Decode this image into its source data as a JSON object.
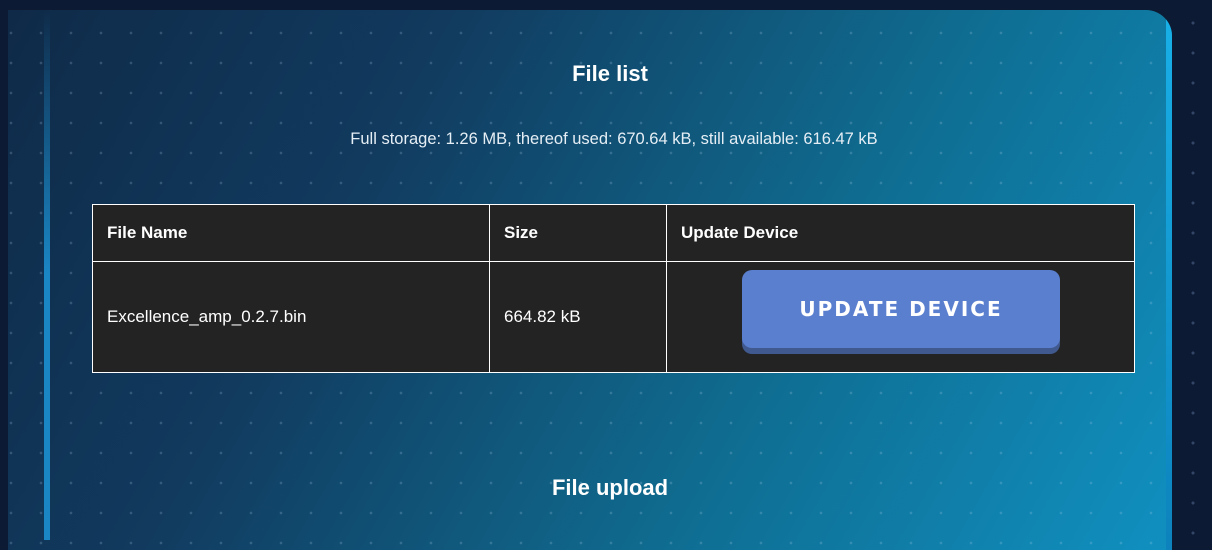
{
  "file_list": {
    "title": "File list",
    "storage_info": "Full storage: 1.26 MB, thereof used: 670.64 kB, still available: 616.47 kB",
    "columns": [
      "File Name",
      "Size",
      "Update Device"
    ],
    "rows": [
      {
        "file_name": "Excellence_amp_0.2.7.bin",
        "size": "664.82 kB",
        "action_label": "UPDATE DEVICE"
      }
    ]
  },
  "file_upload": {
    "title": "File upload"
  },
  "colors": {
    "button": "#5b7fcf",
    "table_bg": "#232323",
    "accent": "#1090c0"
  }
}
